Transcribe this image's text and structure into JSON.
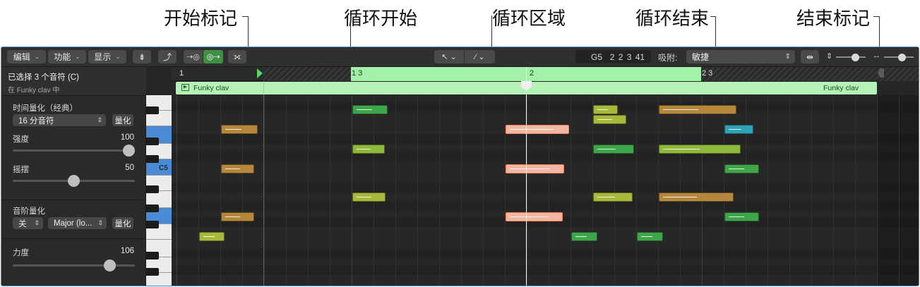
{
  "callouts": {
    "start_marker": "开始标记",
    "cycle_start": "循环开始",
    "cycle_area": "循环区域",
    "cycle_end": "循环结束",
    "end_marker": "结束标记"
  },
  "toolbar": {
    "edit_menu": "编辑",
    "function_menu": "功能",
    "view_menu": "显示",
    "position": "G5",
    "position_detail": "2 2 3 41",
    "snap_label": "吸附:",
    "snap_value": "敏捷"
  },
  "inspector": {
    "selection_title": "已选择 3 个音符 (C)",
    "selection_subtitle": "在 Funky clav 中",
    "time_quantize_label": "时间量化（经典）",
    "time_quantize_value": "16 分音符",
    "quantize_button": "量化",
    "strength_label": "强度",
    "strength_value": "100",
    "swing_label": "摇摆",
    "swing_value": "50",
    "scale_quantize_label": "音阶量化",
    "scale_off": "关",
    "scale_value": "Major (lo...",
    "scale_quantize_button": "量化",
    "velocity_label": "力度",
    "velocity_value": "106"
  },
  "keyboard": {
    "c5_label": "C5"
  },
  "ruler": {
    "bar1": "1",
    "cycle_start": "1 3",
    "bar2": "2",
    "cycle_end": "2 3"
  },
  "region": {
    "name": "Funky clav"
  },
  "colors": {
    "cycle": "#a3f0a8",
    "region": "#b4f2b7",
    "selected_note": "#f2b7a0",
    "accent_blue": "#4a8bd6"
  },
  "notes": [
    {
      "color": "#3fa54a",
      "selected": false
    },
    {
      "color": "#a8b83a",
      "selected": false
    },
    {
      "color": "#a8b83a",
      "selected": false
    },
    {
      "color": "#b5873c",
      "selected": false
    },
    {
      "color": "#b5873c",
      "selected": false
    },
    {
      "color": "#f2b7a0",
      "selected": true
    },
    {
      "color": "#2fa3b5",
      "selected": false
    },
    {
      "color": "#8fb83a",
      "selected": false
    },
    {
      "color": "#3fa54a",
      "selected": false
    },
    {
      "color": "#8fb83a",
      "selected": false
    },
    {
      "color": "#b5873c",
      "selected": false
    },
    {
      "color": "#f2b7a0",
      "selected": true
    },
    {
      "color": "#3fa54a",
      "selected": false
    },
    {
      "color": "#a8b83a",
      "selected": false
    },
    {
      "color": "#a8b83a",
      "selected": false
    },
    {
      "color": "#b5873c",
      "selected": false
    },
    {
      "color": "#b5873c",
      "selected": false
    },
    {
      "color": "#f2b7a0",
      "selected": true
    },
    {
      "color": "#3fa54a",
      "selected": false
    },
    {
      "color": "#a8b83a",
      "selected": false
    },
    {
      "color": "#3fa54a",
      "selected": false
    },
    {
      "color": "#3fa54a",
      "selected": false
    }
  ]
}
